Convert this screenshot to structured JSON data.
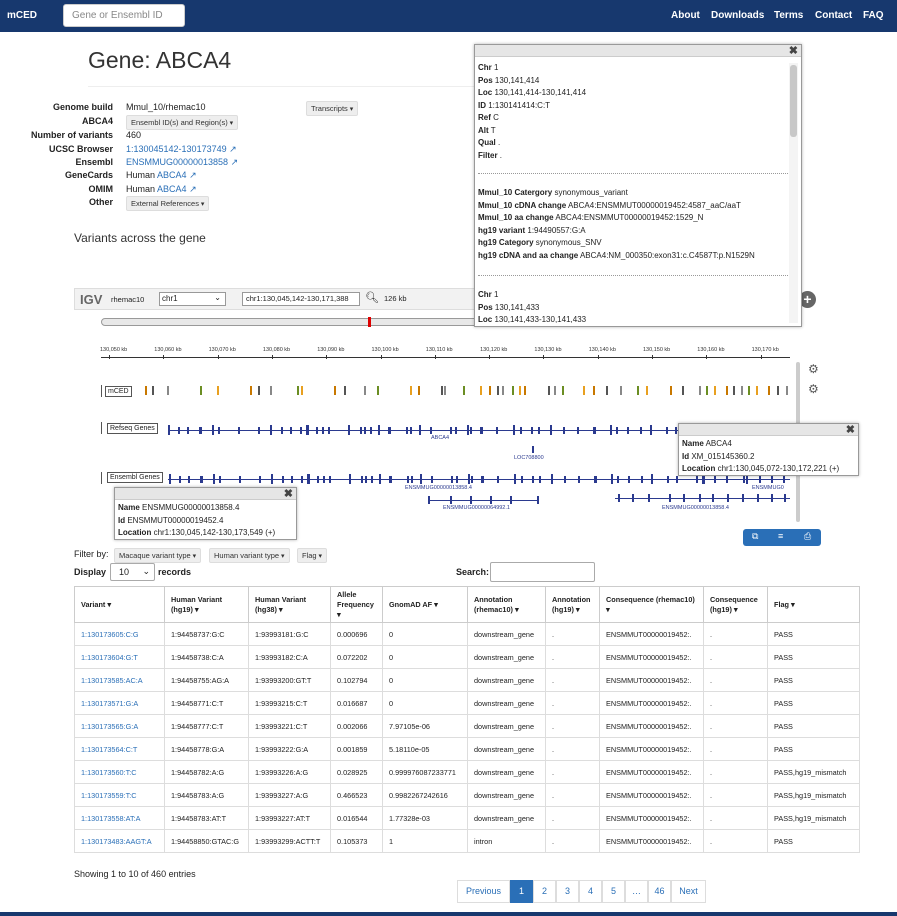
{
  "nav": {
    "brand": "mCED",
    "search_placeholder": "Gene or Ensembl ID",
    "links": [
      "About",
      "Downloads",
      "Terms",
      "Contact",
      "FAQ"
    ]
  },
  "gene": {
    "title": "Gene: ABCA4",
    "transcripts_label": "Transcripts"
  },
  "info": {
    "genome_build_label": "Genome build",
    "genome_build": "Mmul_10/rhemac10",
    "symbol_label": "ABCA4",
    "symbol_dropdown": "Ensembl ID(s) and Region(s)",
    "nvar_label": "Number of variants",
    "nvar": "460",
    "ucsc_label": "UCSC Browser",
    "ucsc": "1:130045142-130173749",
    "ensembl_label": "Ensembl",
    "ensembl": "ENSMMUG00000013858",
    "genecards_label": "GeneCards",
    "genecards_prefix": "Human",
    "genecards": "ABCA4",
    "omim_label": "OMIM",
    "omim_prefix": "Human",
    "omim": "ABCA4",
    "other_label": "Other",
    "other_dropdown": "External References"
  },
  "section_title": "Variants across the gene",
  "igv": {
    "logo": "IGV",
    "genome": "rhemac10",
    "chrom": "chr1",
    "locus": "chr1:130,045,142-130,171,388",
    "width": "126 kb",
    "ruler": [
      "130,050 kb",
      "130,060 kb",
      "130,070 kb",
      "130,080 kb",
      "130,090 kb",
      "130,100 kb",
      "130,110 kb",
      "130,120 kb",
      "130,130 kb",
      "130,140 kb",
      "130,150 kb",
      "130,160 kb",
      "130,170 kb"
    ],
    "tracks": {
      "mced": "mCED",
      "refseq": "Refseq Genes",
      "ensembl": "Ensembl Genes"
    },
    "gene_labels": {
      "abca4": "ABCA4",
      "loc": "LOC708800",
      "ensg1": "ENSMMUG00000013858.4",
      "ensg2": "ENSMMUG00000064992.1",
      "ensg3": "ENSMMUG00000013858.4",
      "ensg4": "ENSMMUG0"
    }
  },
  "popup_variant": {
    "block1": [
      [
        "Chr",
        "1"
      ],
      [
        "Pos",
        "130,141,414"
      ],
      [
        "Loc",
        "130,141,414-130,141,414"
      ],
      [
        "ID",
        "1:130141414:C:T"
      ],
      [
        "Ref",
        "C"
      ],
      [
        "Alt",
        "T"
      ],
      [
        "Qual",
        "."
      ],
      [
        "Filter",
        "."
      ]
    ],
    "block2": [
      [
        "Mmul_10 Catergory",
        "synonymous_variant"
      ],
      [
        "Mmul_10 cDNA change",
        "ABCA4:ENSMMUT00000019452:4587_aaC/aaT"
      ],
      [
        "Mmul_10 aa change",
        "ABCA4:ENSMMUT00000019452:1529_N"
      ],
      [
        "hg19 variant",
        "1:94490557:G:A"
      ],
      [
        "hg19 Category",
        "synonymous_SNV"
      ],
      [
        "hg19 cDNA and aa change",
        "ABCA4:NM_000350:exon31:c.C4587T:p.N1529N"
      ]
    ],
    "block3": [
      [
        "Chr",
        "1"
      ],
      [
        "Pos",
        "130,141,433"
      ],
      [
        "Loc",
        "130,141,433-130,141,433"
      ]
    ]
  },
  "popup_refseq": [
    [
      "Name",
      "ABCA4"
    ],
    [
      "Id",
      "XM_015145360.2"
    ],
    [
      "Location",
      "chr1:130,045,072-130,172,221 (+)"
    ]
  ],
  "popup_ensembl": [
    [
      "Name",
      "ENSMMUG00000013858.4"
    ],
    [
      "Id",
      "ENSMMUT00000019452.4"
    ],
    [
      "Location",
      "chr1:130,045,142-130,173,549 (+)"
    ]
  ],
  "filters": {
    "label": "Filter by:",
    "macaque": "Macaque variant type",
    "human": "Human variant type",
    "flag": "Flag"
  },
  "table_controls": {
    "display": "Display",
    "records": "records",
    "length": "10",
    "search": "Search:"
  },
  "table": {
    "headers": [
      "Variant",
      "Human Variant (hg19)",
      "Human Variant (hg38)",
      "Allele Frequency",
      "GnomAD AF",
      "Annotation (rhemac10)",
      "Annotation (hg19)",
      "Consequence (rhemac10)",
      "Consequence (hg19)",
      "Flag"
    ],
    "rows": [
      [
        "1:130173605:C:G",
        "1:94458737:G:C",
        "1:93993181:G:C",
        "0.000696",
        "0",
        "downstream_gene",
        ".",
        "ENSMMUT00000019452:.",
        ".",
        "PASS"
      ],
      [
        "1:130173604:G:T",
        "1:94458738:C:A",
        "1:93993182:C:A",
        "0.072202",
        "0",
        "downstream_gene",
        ".",
        "ENSMMUT00000019452:.",
        ".",
        "PASS"
      ],
      [
        "1:130173585:AC:A",
        "1:94458755:AG:A",
        "1:93993200:GT:T",
        "0.102794",
        "0",
        "downstream_gene",
        ".",
        "ENSMMUT00000019452:.",
        ".",
        "PASS"
      ],
      [
        "1:130173571:G:A",
        "1:94458771:C:T",
        "1:93993215:C:T",
        "0.016687",
        "0",
        "downstream_gene",
        ".",
        "ENSMMUT00000019452:.",
        ".",
        "PASS"
      ],
      [
        "1:130173565:G:A",
        "1:94458777:C:T",
        "1:93993221:C:T",
        "0.002066",
        "7.97105e-06",
        "downstream_gene",
        ".",
        "ENSMMUT00000019452:.",
        ".",
        "PASS"
      ],
      [
        "1:130173564:C:T",
        "1:94458778:G:A",
        "1:93993222:G:A",
        "0.001859",
        "5.18110e-05",
        "downstream_gene",
        ".",
        "ENSMMUT00000019452:.",
        ".",
        "PASS"
      ],
      [
        "1:130173560:T:C",
        "1:94458782:A:G",
        "1:93993226:A:G",
        "0.028925",
        "0.999976087233771",
        "downstream_gene",
        ".",
        "ENSMMUT00000019452:.",
        ".",
        "PASS,hg19_mismatch"
      ],
      [
        "1:130173559:T:C",
        "1:94458783:A:G",
        "1:93993227:A:G",
        "0.466523",
        "0.9982267242616",
        "downstream_gene",
        ".",
        "ENSMMUT00000019452:.",
        ".",
        "PASS,hg19_mismatch"
      ],
      [
        "1:130173558:AT:A",
        "1:94458783:AT:T",
        "1:93993227:AT:T",
        "0.016544",
        "1.77328e-03",
        "downstream_gene",
        ".",
        "ENSMMUT00000019452:.",
        ".",
        "PASS,hg19_mismatch"
      ],
      [
        "1:130173483:AAGT:A",
        "1:94458850:GTAC:G",
        "1:93993299:ACTT:T",
        "0.105373",
        "1",
        "intron",
        ".",
        "ENSMMUT00000019452:.",
        ".",
        "PASS"
      ]
    ]
  },
  "footer": {
    "showing": "Showing 1 to 10 of 460 entries"
  },
  "pagination": {
    "previous": "Previous",
    "pages": [
      "1",
      "2",
      "3",
      "4",
      "5",
      "…",
      "46"
    ],
    "next": "Next",
    "active": "1"
  },
  "colors": {
    "navbar": "#17386e",
    "link": "#2a6fb7",
    "track": "#2b3a8f",
    "page_active": "#2a6fb7"
  }
}
